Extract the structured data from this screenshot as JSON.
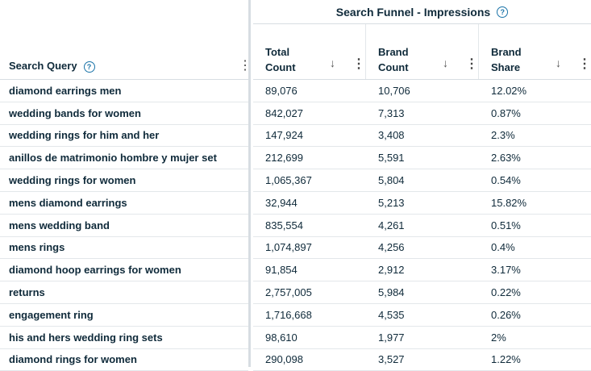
{
  "group_header": {
    "title": "Search Funnel - Impressions",
    "help": "?"
  },
  "query_column": {
    "label": "Search Query",
    "help": "?"
  },
  "metric_columns": [
    {
      "line1": "Total",
      "line2": "Count"
    },
    {
      "line1": "Brand",
      "line2": "Count"
    },
    {
      "line1": "Brand",
      "line2": "Share"
    }
  ],
  "icons": {
    "sort": "↓",
    "menu": "⋮"
  },
  "rows": [
    {
      "query": "diamond earrings men",
      "total": "89,076",
      "brand": "10,706",
      "share": "12.02%"
    },
    {
      "query": "wedding bands for women",
      "total": "842,027",
      "brand": "7,313",
      "share": "0.87%"
    },
    {
      "query": "wedding rings for him and her",
      "total": "147,924",
      "brand": "3,408",
      "share": "2.3%"
    },
    {
      "query": "anillos de matrimonio hombre y mujer set",
      "total": "212,699",
      "brand": "5,591",
      "share": "2.63%"
    },
    {
      "query": "wedding rings for women",
      "total": "1,065,367",
      "brand": "5,804",
      "share": "0.54%"
    },
    {
      "query": "mens diamond earrings",
      "total": "32,944",
      "brand": "5,213",
      "share": "15.82%"
    },
    {
      "query": "mens wedding band",
      "total": "835,554",
      "brand": "4,261",
      "share": "0.51%"
    },
    {
      "query": "mens rings",
      "total": "1,074,897",
      "brand": "4,256",
      "share": "0.4%"
    },
    {
      "query": "diamond hoop earrings for women",
      "total": "91,854",
      "brand": "2,912",
      "share": "3.17%"
    },
    {
      "query": "returns",
      "total": "2,757,005",
      "brand": "5,984",
      "share": "0.22%"
    },
    {
      "query": "engagement ring",
      "total": "1,716,668",
      "brand": "4,535",
      "share": "0.26%"
    },
    {
      "query": "his and hers wedding ring sets",
      "total": "98,610",
      "brand": "1,977",
      "share": "2%"
    },
    {
      "query": "diamond rings for women",
      "total": "290,098",
      "brand": "3,527",
      "share": "1.22%"
    }
  ]
}
